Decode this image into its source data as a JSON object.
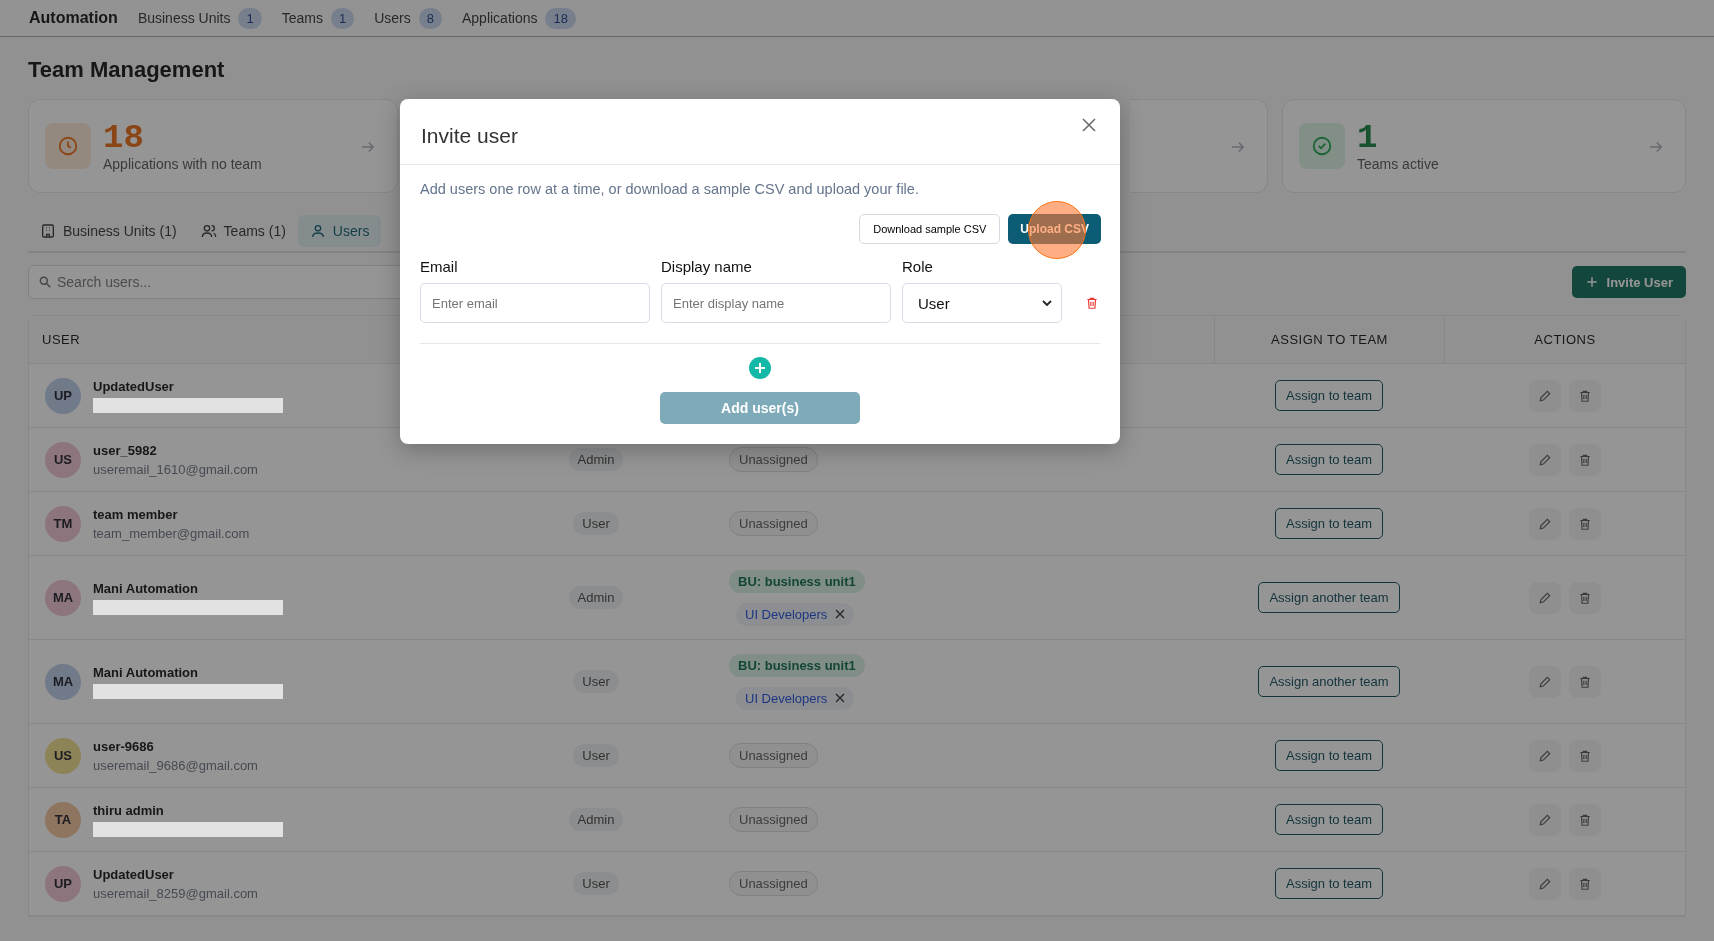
{
  "top_nav": {
    "brand": "Automation",
    "links": [
      {
        "label": "Business Units",
        "count": "1"
      },
      {
        "label": "Teams",
        "count": "1"
      },
      {
        "label": "Users",
        "count": "8"
      },
      {
        "label": "Applications",
        "count": "18"
      }
    ]
  },
  "page_title": "Team Management",
  "stats": [
    {
      "kind": "clock",
      "value": "18",
      "label": "Applications with no team"
    },
    {
      "kind": "covered"
    },
    {
      "kind": "check",
      "value": "1",
      "label": "Teams active"
    }
  ],
  "tabs": [
    {
      "kind": "building",
      "label": "Business Units (1)",
      "selected": false
    },
    {
      "kind": "people",
      "label": "Teams (1)",
      "selected": false
    },
    {
      "kind": "person",
      "label": "Users",
      "selected": true
    }
  ],
  "search": {
    "placeholder": "Search users..."
  },
  "invite_button": "Invite User",
  "table": {
    "columns": [
      "USER",
      "",
      "",
      "ASSIGN TO TEAM",
      "ACTIONS"
    ],
    "rows": [
      {
        "initials": "UP",
        "color": "#707a88",
        "name": "UpdatedUser",
        "redacted": true,
        "role": "",
        "teams": [],
        "assign": "Assign to team"
      },
      {
        "initials": "US",
        "color": "#8d757e",
        "name": "user_5982",
        "redacted": false,
        "email": "useremail_1610@gmail.com",
        "role": "Admin",
        "teams": [
          {
            "kind": "unassigned",
            "label": "Unassigned"
          }
        ],
        "assign": "Assign to team"
      },
      {
        "initials": "TM",
        "color": "#8d757e",
        "name": "team member",
        "redacted": false,
        "email": "team_member@gmail.com",
        "role": "User",
        "teams": [
          {
            "kind": "unassigned",
            "label": "Unassigned"
          }
        ],
        "assign": "Assign to team"
      },
      {
        "initials": "MA",
        "color": "#8d757e",
        "name": "Mani Automation",
        "redacted": true,
        "role": "Admin",
        "teams": [
          {
            "kind": "business_unit",
            "label": "BU: business unit1"
          },
          {
            "kind": "team",
            "label": "UI Developers"
          }
        ],
        "assign": "Assign another team"
      },
      {
        "initials": "MA",
        "color": "#707a88",
        "name": "Mani Automation",
        "redacted": true,
        "role": "User",
        "teams": [
          {
            "kind": "business_unit",
            "label": "BU: business unit1"
          },
          {
            "kind": "team",
            "label": "UI Developers"
          }
        ],
        "assign": "Assign another team"
      },
      {
        "initials": "US",
        "color": "#8c8357",
        "name": "user-9686",
        "redacted": false,
        "email": "useremail_9686@gmail.com",
        "role": "User",
        "teams": [
          {
            "kind": "unassigned",
            "label": "Unassigned"
          }
        ],
        "assign": "Assign to team"
      },
      {
        "initials": "TA",
        "color": "#8e7560",
        "name": "thiru admin",
        "redacted": true,
        "role": "Admin",
        "teams": [
          {
            "kind": "unassigned",
            "label": "Unassigned"
          }
        ],
        "assign": "Assign to team"
      },
      {
        "initials": "UP",
        "color": "#8d757e",
        "name": "UpdatedUser",
        "redacted": false,
        "email": "useremail_8259@gmail.com",
        "role": "User",
        "teams": [
          {
            "kind": "unassigned",
            "label": "Unassigned"
          }
        ],
        "assign": "Assign to team"
      }
    ]
  },
  "modal": {
    "title": "Invite user",
    "description": "Add users one row at a time, or download a sample CSV and upload your file.",
    "download_button": "Download sample CSV",
    "upload_button": "Upload CSV",
    "click_marker": true,
    "labels": [
      "Email",
      "Display name",
      "Role"
    ],
    "rows": [
      {
        "email_placeholder": "Enter email",
        "name_placeholder": "Enter display name",
        "role": "User"
      }
    ],
    "submit_button": "Add user(s)",
    "submit_disabled": true
  }
}
